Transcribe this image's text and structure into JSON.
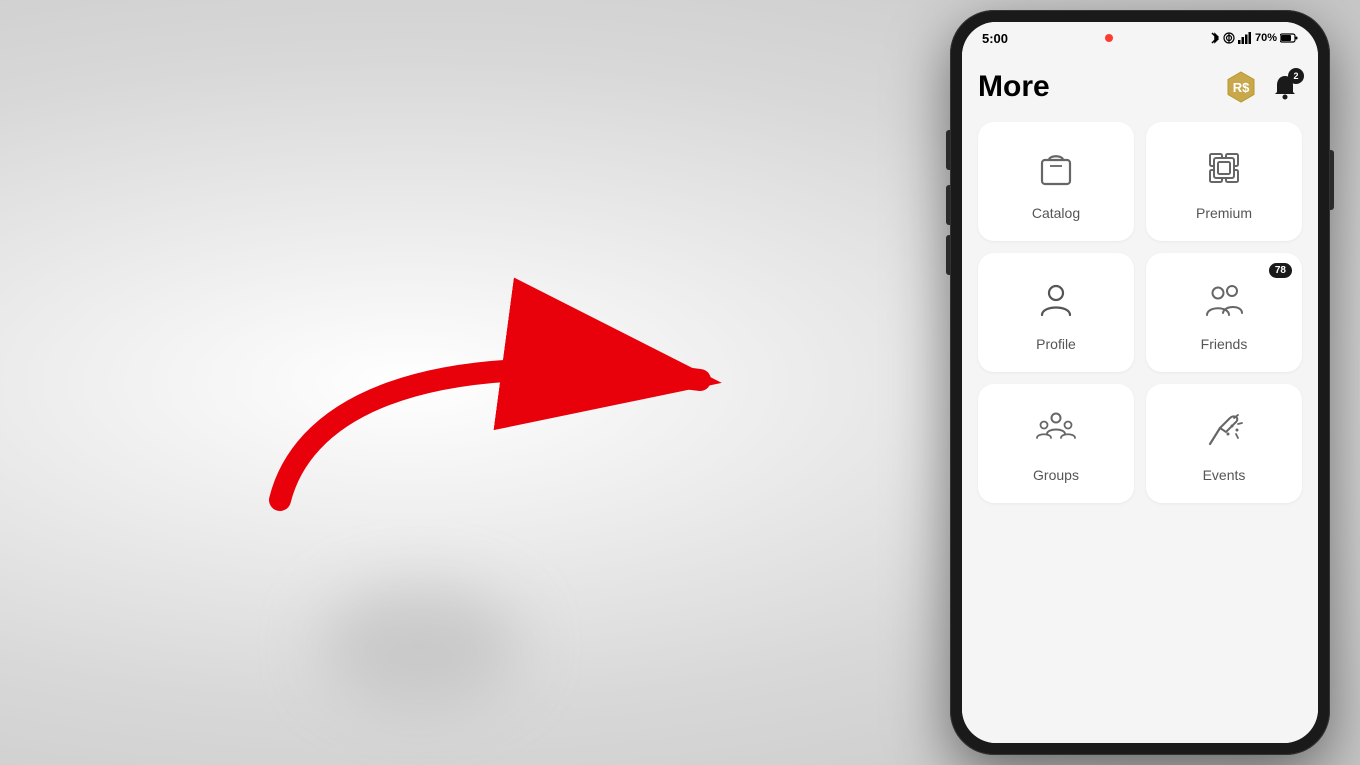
{
  "background": {
    "color": "#e0e0e0"
  },
  "phone": {
    "status_bar": {
      "time": "5:00",
      "battery": "70%"
    },
    "header": {
      "title": "More",
      "robux_icon": "robux-icon",
      "notification_badge": "2"
    },
    "grid": {
      "items": [
        {
          "id": "catalog",
          "label": "Catalog",
          "icon": "shopping-bag-icon",
          "badge": null
        },
        {
          "id": "premium",
          "label": "Premium",
          "icon": "premium-icon",
          "badge": null
        },
        {
          "id": "profile",
          "label": "Profile",
          "icon": "person-icon",
          "badge": null
        },
        {
          "id": "friends",
          "label": "Friends",
          "icon": "friends-icon",
          "badge": "78"
        },
        {
          "id": "groups",
          "label": "Groups",
          "icon": "groups-icon",
          "badge": null
        },
        {
          "id": "events",
          "label": "Events",
          "icon": "events-icon",
          "badge": null
        }
      ]
    }
  },
  "arrow": {
    "color": "#e8000a"
  }
}
